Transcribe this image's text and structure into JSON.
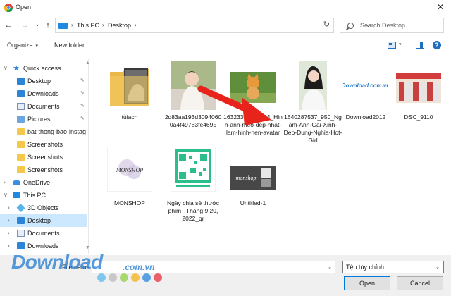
{
  "window": {
    "title": "Open",
    "close_glyph": "✕"
  },
  "nav": {
    "back": "←",
    "forward": "→",
    "dropdown": "⌄",
    "up": "↑",
    "refresh": "↻"
  },
  "address": {
    "crumbs": [
      "This PC",
      "Desktop"
    ],
    "separator": "›"
  },
  "search": {
    "placeholder": "Search Desktop"
  },
  "toolbar": {
    "organize_label": "Organize",
    "new_folder_label": "New folder",
    "help_glyph": "?"
  },
  "sidebar": {
    "items": [
      {
        "label": "Quick access",
        "icon": "star-icon",
        "level": 0,
        "chevron": "∨"
      },
      {
        "label": "Desktop",
        "icon": "desktop-folder-icon",
        "level": 1,
        "pinned": true
      },
      {
        "label": "Downloads",
        "icon": "download-icon",
        "level": 1,
        "pinned": true
      },
      {
        "label": "Documents",
        "icon": "documents-icon",
        "level": 1,
        "pinned": true
      },
      {
        "label": "Pictures",
        "icon": "pictures-icon",
        "level": 1,
        "pinned": true
      },
      {
        "label": "bat-thong-bao-instag",
        "icon": "folder-icon",
        "level": 1
      },
      {
        "label": "Screenshots",
        "icon": "folder-icon",
        "level": 1
      },
      {
        "label": "Screenshots",
        "icon": "folder-icon",
        "level": 1
      },
      {
        "label": "Screenshots",
        "icon": "folder-icon",
        "level": 1
      },
      {
        "label": "OneDrive",
        "icon": "cloud-icon",
        "level": 0,
        "chevron": "›"
      },
      {
        "label": "This PC",
        "icon": "pc-icon",
        "level": 0,
        "chevron": "∨"
      },
      {
        "label": "3D Objects",
        "icon": "3d-objects-icon",
        "level": 1,
        "chevron": "›"
      },
      {
        "label": "Desktop",
        "icon": "desktop-folder-icon",
        "level": 1,
        "chevron": "›",
        "selected": true
      },
      {
        "label": "Documents",
        "icon": "documents-icon",
        "level": 1,
        "chevron": "›"
      },
      {
        "label": "Downloads",
        "icon": "download-icon",
        "level": 1,
        "chevron": "›"
      }
    ],
    "pin_glyph": "📌"
  },
  "files": [
    {
      "label": "tủiach",
      "thumb": "folder"
    },
    {
      "label": "2d83aa193d30940600a4f49783fe4695",
      "thumb": "photo-child"
    },
    {
      "label": "1632330867_854_Hinh-anh-meo-dep-nhat-lam-hinh-nen-avatar",
      "thumb": "photo-cat"
    },
    {
      "label": "1640287537_950_Ngam-Anh-Gai-Xinh-Dep-Dung-Nghia-Hot-Girl",
      "thumb": "photo-girl"
    },
    {
      "label": "Download2012",
      "thumb": "logo-download",
      "thumb_text": "Download.com.vn"
    },
    {
      "label": "DSC_9110",
      "thumb": "photo-group"
    },
    {
      "label": "MONSHOP",
      "thumb": "logo-monshop",
      "thumb_text": "MONSHOP"
    },
    {
      "label": "Ngày chia sẻ thước phim_ Tháng 9 20, 2022_qr",
      "thumb": "qr-code"
    },
    {
      "label": "Untitled-1",
      "thumb": "banner-monshop",
      "thumb_text": "monshop"
    }
  ],
  "footer": {
    "file_name_label": "File name:",
    "file_name_value": "",
    "filter_value": "Tệp tùy chỉnh",
    "open_label": "Open",
    "cancel_label": "Cancel"
  },
  "watermark": {
    "text": "Download",
    "suffix": ".com.vn",
    "dot_colors": [
      "#7ec8f0",
      "#c8c8c8",
      "#a6d86e",
      "#f2c14e",
      "#5aa0e0",
      "#e8606a"
    ]
  },
  "colors": {
    "accent": "#0078d7",
    "selection": "#cce8ff",
    "arrow": "#e8231c"
  }
}
